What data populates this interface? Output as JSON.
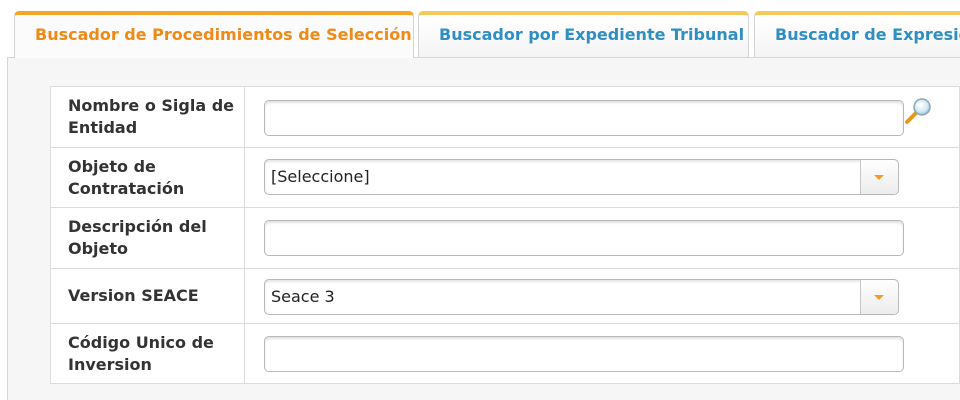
{
  "tabs": [
    {
      "label": "Buscador de Procedimientos de Selección",
      "active": true
    },
    {
      "label": "Buscador por Expediente Tribunal",
      "active": false
    },
    {
      "label": "Buscador de Expresiones",
      "active": false
    }
  ],
  "form": {
    "entidad_label": "Nombre o Sigla de Entidad",
    "entidad_value": "",
    "objeto_label": "Objeto de Contratación",
    "objeto_value": "[Seleccione]",
    "descripcion_label": "Descripción del Objeto",
    "descripcion_value": "",
    "version_label": "Version SEACE",
    "version_value": "Seace 3",
    "codigo_label": "Código Unico de Inversion",
    "codigo_value": ""
  },
  "icons": {
    "entity_search": "magnifier-icon",
    "dropdown": "chevron-down-icon"
  },
  "colors": {
    "active_tab_text": "#ef8a17",
    "inactive_tab_text": "#2f8fc2",
    "tab_accent": "#f2a826",
    "dropdown_arrow": "#f0a020"
  }
}
